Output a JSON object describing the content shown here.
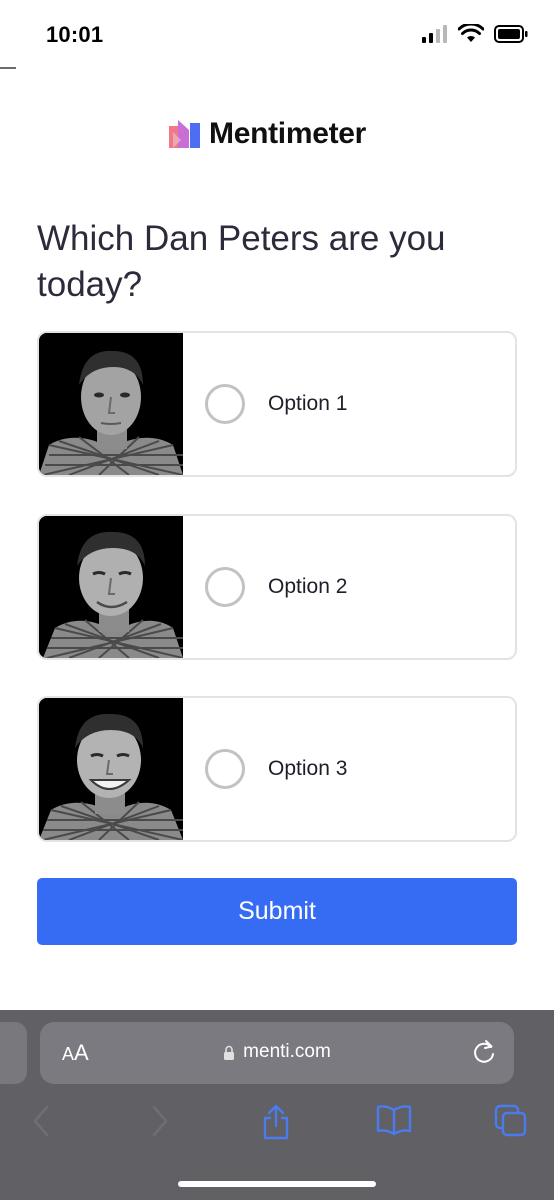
{
  "status_bar": {
    "time": "10:01"
  },
  "app": {
    "logo_text": "Mentimeter"
  },
  "question": {
    "text": "Which Dan Peters are you today?"
  },
  "options": [
    {
      "label": "Option 1",
      "image": "portrait-photo"
    },
    {
      "label": "Option 2",
      "image": "portrait-photo"
    },
    {
      "label": "Option 3",
      "image": "portrait-photo"
    }
  ],
  "submit": {
    "label": "Submit"
  },
  "browser": {
    "aa_small": "A",
    "aa_large": "A",
    "url": "menti.com",
    "icons": [
      "lock-icon",
      "reload-icon",
      "back-icon",
      "forward-icon",
      "share-icon",
      "bookmarks-icon",
      "tabs-icon"
    ]
  },
  "colors": {
    "accent": "#366cf4",
    "browser_bar": "#606065",
    "toolbar_icon": "#4a7cf0"
  }
}
